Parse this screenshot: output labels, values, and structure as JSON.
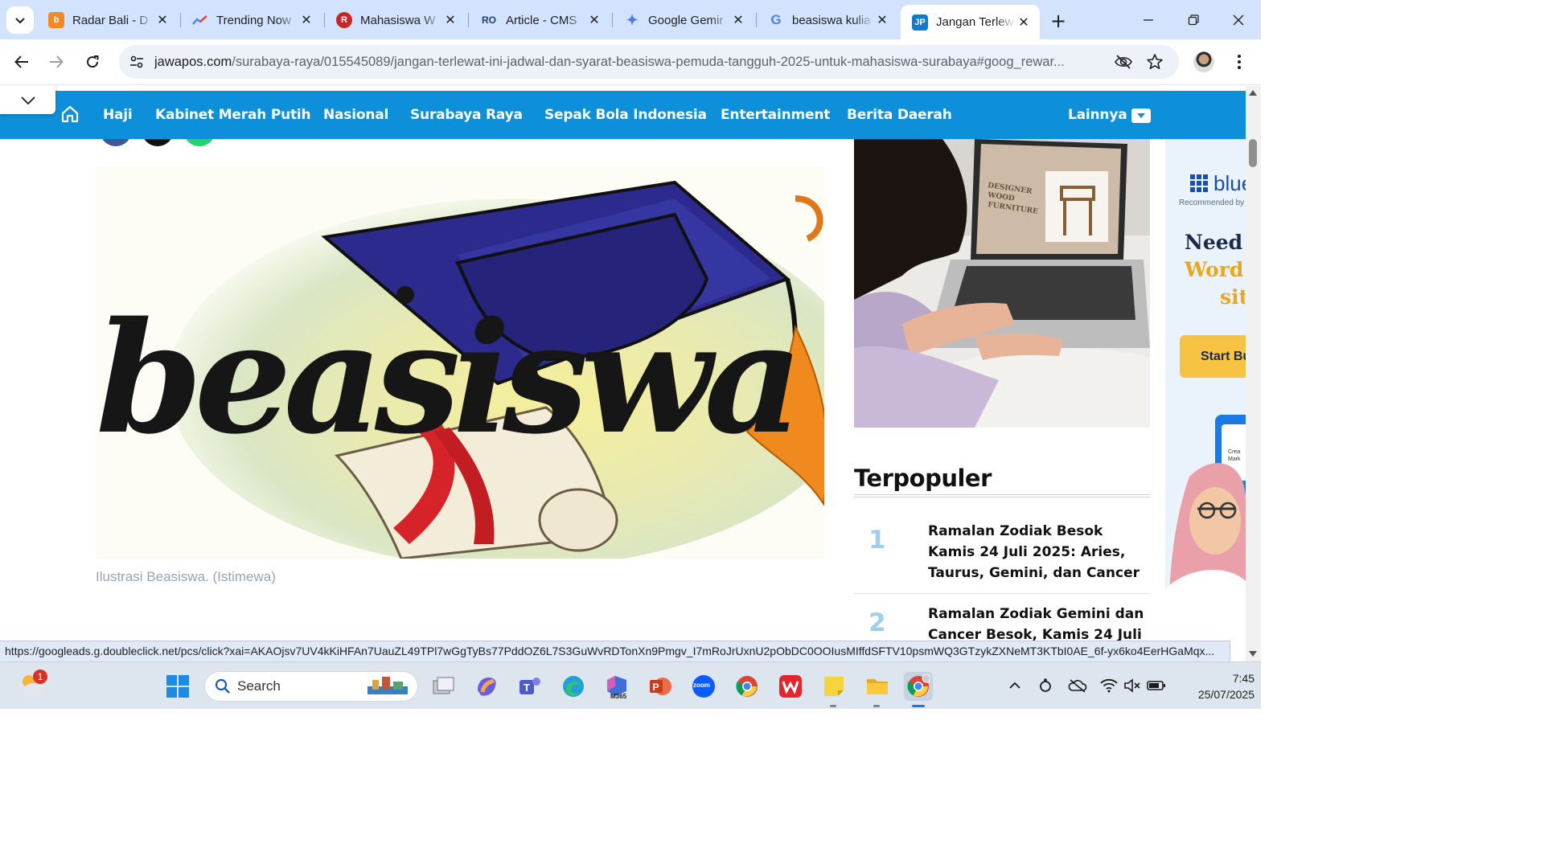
{
  "browser": {
    "tabs": [
      {
        "title": "Radar Bali - D",
        "favicon_color": "#f08a24",
        "favicon_glyph": "b",
        "active": false
      },
      {
        "title": "Trending Now",
        "favicon_color": "#ffffff",
        "favicon_glyph": "~",
        "active": false
      },
      {
        "title": "Mahasiswa W",
        "favicon_color": "#c62828",
        "favicon_glyph": "R",
        "active": false
      },
      {
        "title": "Article - CMS",
        "favicon_color": "#ffffff",
        "favicon_glyph": "RO",
        "active": false
      },
      {
        "title": "Google Gemir",
        "favicon_color": "#ffffff",
        "favicon_glyph": "✦",
        "active": false
      },
      {
        "title": "beasiswa kulia",
        "favicon_color": "#ffffff",
        "favicon_glyph": "G",
        "active": false
      },
      {
        "title": "Jangan Terlew",
        "favicon_color": "#1479c9",
        "favicon_glyph": "JP",
        "active": true
      }
    ],
    "url_host": "jawapos.com",
    "url_path": "/surabaya-raya/015545089/jangan-terlewat-ini-jadwal-dan-syarat-beasiswa-pemuda-tangguh-2025-untuk-mahasiswa-surabaya#goog_rewar...",
    "status_url": "https://googleads.g.doubleclick.net/pcs/click?xai=AKAOjsv7UV4kKiHFAn7UauZL49TPl7wGgTyBs77PddOZ6L7S3GuWvRDTonXn9Pmgv_I7mRoJrUxnU2pObDC0OOIusMIffdSFTV10psmWQ3GTzykZXNeMT3KTbI0AE_6f-yx6ko4EerHGaMqx..."
  },
  "site": {
    "nav": [
      "Haji",
      "Kabinet Merah Putih",
      "Nasional",
      "Surabaya Raya",
      "Sepak Bola Indonesia",
      "Entertainment",
      "Berita Daerah"
    ],
    "more_label": "Lainnya",
    "accent": "#0d8fd9"
  },
  "article": {
    "caption": "Ilustrasi Beasiswa. (Istimewa)",
    "image_word": "beasiswa"
  },
  "sidebar": {
    "ad_image_text": [
      "DESIGNER",
      "WOOD",
      "FURNITURE"
    ],
    "popular_title": "Terpopuler",
    "popular": [
      {
        "rank": "1",
        "title": "Ramalan Zodiak Besok Kamis 24 Juli 2025: Aries, Taurus, Gemini, dan Cancer"
      },
      {
        "rank": "2",
        "title": "Ramalan Zodiak Gemini dan Cancer Besok, Kamis 24 Juli"
      }
    ]
  },
  "right_ad": {
    "logo": "blue",
    "sub": "Recommended by",
    "headline_1": "Need a",
    "headline_2": "Word",
    "headline_3": "site",
    "cta": "Start Bu",
    "card_text": "Crea Mark"
  },
  "taskbar": {
    "search_label": "Search",
    "weather_badge": "1",
    "m365_label": "M365",
    "zoom_label": "zoom",
    "time": "7:45",
    "date": "25/07/2025"
  }
}
